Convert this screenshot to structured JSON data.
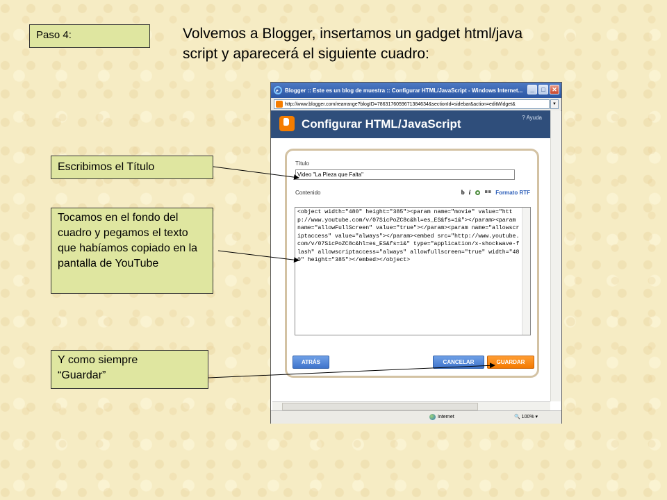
{
  "slide": {
    "step_label": "Paso 4:",
    "heading_line1": "Volvemos a Blogger, insertamos un gadget html/java",
    "heading_line2": "script y aparecerá el siguiente cuadro:",
    "callout_title": "Escribimos el Título",
    "callout_paste": "Tocamos en el fondo del cuadro y pegamos el texto que habíamos copiado en la pantalla de YouTube",
    "callout_save_line1": "Y como siempre",
    "callout_save_line2": "“Guardar”"
  },
  "browser": {
    "window_title": "Blogger :: Este es un blog de muestra :: Configurar HTML/JavaScript - Windows Internet...",
    "address": "http://www.blogger.com/rearrange?blogID=7863176059671384634&sectionId=sidebar&action=editWidget&",
    "status_zone": "Internet",
    "zoom": "100%"
  },
  "dialog": {
    "header_title": "Configurar HTML/JavaScript",
    "help_label": "? Ayuda",
    "title_label": "Título",
    "title_value": "Video \"La Pieza que Falta\"",
    "content_label": "Contenido",
    "toolbar": {
      "bold": "b",
      "italic": "i",
      "rtf_label": "Formato RTF"
    },
    "content_value": "<object width=\"480\" height=\"385\"><param name=\"movie\" value=\"http://www.youtube.com/v/07SicPoZC8c&hl=es_ES&fs=1&\"></param><param name=\"allowFullScreen\" value=\"true\"></param><param name=\"allowscriptaccess\" value=\"always\"></param><embed src=\"http://www.youtube.com/v/07SicPoZC8c&hl=es_ES&fs=1&\" type=\"application/x-shockwave-flash\" allowscriptaccess=\"always\" allowfullscreen=\"true\" width=\"480\" height=\"385\"></embed></object>",
    "back_label": "ATRÁS",
    "cancel_label": "CANCELAR",
    "save_label": "GUARDAR"
  },
  "colors": {
    "callout_bg": "#dfe6a0",
    "header_bg": "#2f4e7b",
    "blue_button": "#3f74cc",
    "orange_button": "#f47a00"
  }
}
